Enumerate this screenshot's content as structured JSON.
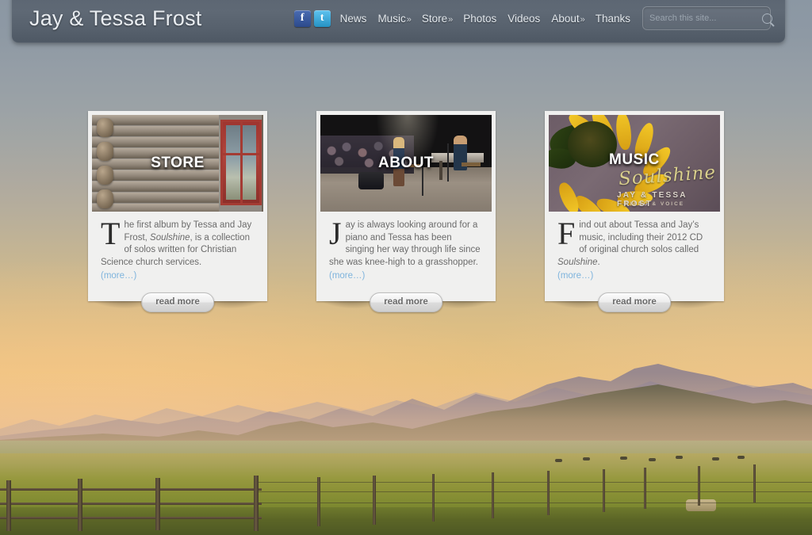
{
  "header": {
    "site_title": "Jay & Tessa Frost",
    "social": [
      {
        "name": "facebook",
        "glyph": "f"
      },
      {
        "name": "twitter",
        "glyph": "t"
      }
    ],
    "nav": [
      {
        "label": "News",
        "chevron": ""
      },
      {
        "label": "Music",
        "chevron": "»"
      },
      {
        "label": "Store",
        "chevron": "»"
      },
      {
        "label": "Photos",
        "chevron": ""
      },
      {
        "label": "Videos",
        "chevron": ""
      },
      {
        "label": "About",
        "chevron": "»"
      },
      {
        "label": "Thanks",
        "chevron": ""
      }
    ],
    "search": {
      "placeholder": "Search this site...",
      "value": "",
      "icon": "search-icon"
    }
  },
  "cards": [
    {
      "id": "store",
      "overlay_title": "STORE",
      "dropcap": "T",
      "text_before_italic": "he first album by Tessa and Jay Frost, ",
      "italic": "Soulshine",
      "text_after_italic": ", is a collection of solos written for Christian Science church services.",
      "more_label": "(more…)",
      "button_label": "read more"
    },
    {
      "id": "about",
      "overlay_title": "ABOUT",
      "dropcap": "J",
      "text_before_italic": "ay is always looking around for a piano and Tessa has been singing her way through life since she was knee-high to a grasshopper.",
      "italic": "",
      "text_after_italic": "",
      "more_label": "(more…)",
      "button_label": "read more"
    },
    {
      "id": "music",
      "overlay_title": "MUSIC",
      "dropcap": "F",
      "text_before_italic": "ind out about Tessa and Jay’s music, including their 2012 CD of original church solos called ",
      "italic": "Soulshine",
      "text_after_italic": ".",
      "more_label": "(more…)",
      "button_label": "read more"
    }
  ],
  "album_art": {
    "script_title": "Soulshine",
    "artist": "JAY & TESSA FROST",
    "subtitle": "PIANO & VOICE"
  },
  "colors": {
    "header_bg": "#5b6572",
    "title_text": "#e9edf1",
    "nav_text": "#e3e8ed",
    "card_bg": "#f0f0ef",
    "link_blue": "#7fb4dd",
    "body_text": "#6b6b6b",
    "facebook": "#3b5998",
    "twitter": "#3fb0e0",
    "sky_top": "#8b97a3",
    "sky_bottom": "#e6b97c",
    "field_green": "#8b9136"
  }
}
